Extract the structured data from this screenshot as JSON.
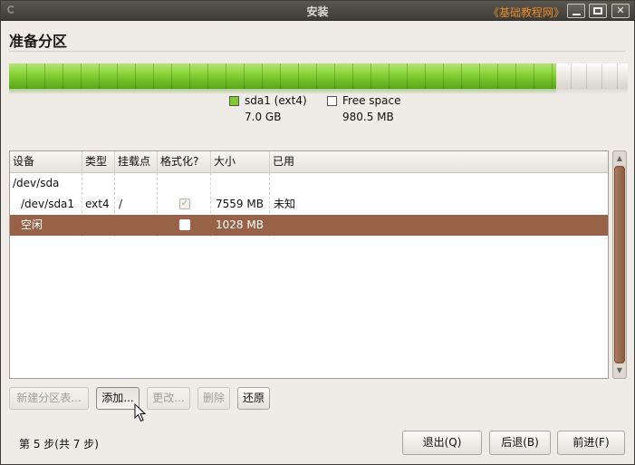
{
  "window": {
    "title": "安装",
    "watermark": "《基础教程网》",
    "controls": {
      "minimize": "_",
      "maximize": "□",
      "close": "✕"
    }
  },
  "heading": "准备分区",
  "partition_bar": {
    "used_fraction": 0.8838,
    "used_color": "#7ecb2e",
    "free_color": "#ffffff"
  },
  "legend": [
    {
      "name": "sda1 (ext4)",
      "size": "7.0 GB",
      "color": "#7ecb2e"
    },
    {
      "name": "Free space",
      "size": "980.5 MB",
      "color": "#ffffff"
    }
  ],
  "table": {
    "columns": [
      "设备",
      "类型",
      "挂载点",
      "格式化?",
      "大小",
      "已用"
    ],
    "rows": [
      {
        "device": "/dev/sda",
        "type": "",
        "mount": "",
        "format": null,
        "size": "",
        "used": "",
        "selected": false
      },
      {
        "device": "/dev/sda1",
        "type": "ext4",
        "mount": "/",
        "format": true,
        "size": "7559 MB",
        "used": "未知",
        "selected": false
      },
      {
        "device": "空闲",
        "type": "",
        "mount": "",
        "format": false,
        "size": "1028 MB",
        "used": "",
        "selected": true
      }
    ]
  },
  "table_actions": {
    "new_table": "新建分区表...",
    "add": "添加...",
    "change": "更改...",
    "delete": "删除",
    "revert": "还原"
  },
  "footer": {
    "step": "第 5 步(共 7 步)",
    "quit": "退出(Q)",
    "back": "后退(B)",
    "forward": "前进(F)"
  }
}
